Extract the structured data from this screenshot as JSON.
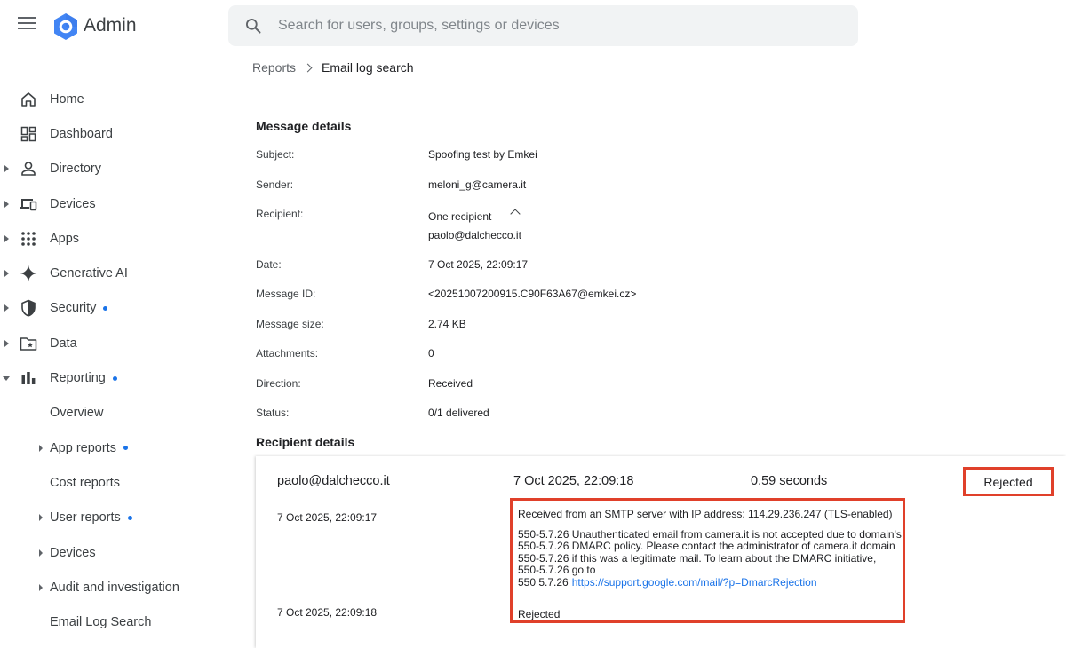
{
  "app": {
    "title": "Admin"
  },
  "search": {
    "placeholder": "Search for users, groups, settings or devices"
  },
  "sidebar": {
    "items": [
      {
        "label": "Home",
        "icon": "home-icon",
        "arrow": false,
        "dot": false
      },
      {
        "label": "Dashboard",
        "icon": "dashboard-icon",
        "arrow": false,
        "dot": false
      },
      {
        "label": "Directory",
        "icon": "person-icon",
        "arrow": true,
        "dot": false
      },
      {
        "label": "Devices",
        "icon": "devices-icon",
        "arrow": true,
        "dot": false
      },
      {
        "label": "Apps",
        "icon": "apps-grid-icon",
        "arrow": true,
        "dot": false
      },
      {
        "label": "Generative AI",
        "icon": "sparkle-icon",
        "arrow": true,
        "dot": false
      },
      {
        "label": "Security",
        "icon": "shield-icon",
        "arrow": true,
        "dot": true
      },
      {
        "label": "Data",
        "icon": "folder-star-icon",
        "arrow": true,
        "dot": false
      },
      {
        "label": "Reporting",
        "icon": "bar-chart-icon",
        "arrow": true,
        "open": true,
        "dot": true
      }
    ],
    "reporting_sub": [
      {
        "label": "Overview",
        "arrow": false,
        "dot": false
      },
      {
        "label": "App reports",
        "arrow": true,
        "dot": true
      },
      {
        "label": "Cost reports",
        "arrow": false,
        "dot": false
      },
      {
        "label": "User reports",
        "arrow": true,
        "dot": true
      },
      {
        "label": "Devices",
        "arrow": true,
        "dot": false
      },
      {
        "label": "Audit and investigation",
        "arrow": true,
        "dot": false
      },
      {
        "label": "Email Log Search",
        "arrow": false,
        "dot": false
      }
    ]
  },
  "breadcrumb": {
    "parent": "Reports",
    "current": "Email log search"
  },
  "message_details": {
    "title": "Message details",
    "subject_label": "Subject:",
    "subject": "Spoofing test by Emkei",
    "sender_label": "Sender:",
    "sender": "meloni_g@camera.it",
    "recipient_label": "Recipient:",
    "recipient_count": "One recipient",
    "recipient": "paolo@dalchecco.it",
    "date_label": "Date:",
    "date": "7 Oct 2025, 22:09:17",
    "message_id_label": "Message ID:",
    "message_id": "<20251007200915.C90F63A67@emkei.cz>",
    "size_label": "Message size:",
    "size": "2.74 KB",
    "attachments_label": "Attachments:",
    "attachments": "0",
    "direction_label": "Direction:",
    "direction": "Received",
    "status_label": "Status:",
    "status": "0/1 delivered"
  },
  "recipient_details": {
    "title": "Recipient details",
    "email": "paolo@dalchecco.it",
    "timestamp": "7 Oct 2025, 22:09:18",
    "duration": "0.59 seconds",
    "status": "Rejected",
    "event1_time": "7 Oct 2025, 22:09:17",
    "event2_time": "7 Oct 2025, 22:09:18",
    "log_line1": "Received from an SMTP server with IP address: 114.29.236.247 (TLS-enabled)",
    "log_line2": "550-5.7.26 Unauthenticated email from camera.it is not accepted due to domain's",
    "log_line3": "550-5.7.26 DMARC policy. Please contact the administrator of camera.it domain",
    "log_line4": "550-5.7.26 if this was a legitimate mail. To learn about the DMARC initiative,",
    "log_line5": "550-5.7.26 go to",
    "log_line6_prefix": "550 5.7.26",
    "log_link": "https://support.google.com/mail/?p=DmarcRejection",
    "log_final": "Rejected"
  },
  "colors": {
    "accent": "#1a73e8",
    "highlight_border": "#e0402a",
    "logo_blue": "#4285f4"
  }
}
